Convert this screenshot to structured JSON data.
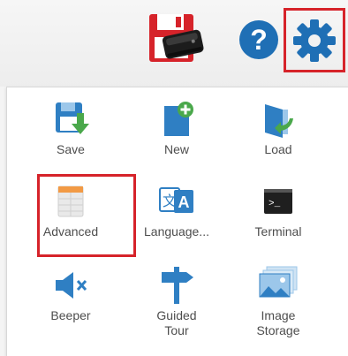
{
  "toolbar": {
    "save_device_icon": "floppy-disk-with-scanner-icon",
    "help_icon": "question-circle-icon",
    "settings_icon": "gear-icon"
  },
  "menu": {
    "items": [
      {
        "label": "Save",
        "icon": "save-down-arrow-icon"
      },
      {
        "label": "New",
        "icon": "new-document-plus-icon"
      },
      {
        "label": "Load",
        "icon": "load-folder-arrow-icon"
      },
      {
        "label": "Advanced",
        "icon": "advanced-table-icon"
      },
      {
        "label": "Language...",
        "icon": "language-translate-icon"
      },
      {
        "label": "Terminal",
        "icon": "terminal-prompt-icon"
      },
      {
        "label": "Beeper",
        "icon": "speaker-mute-icon"
      },
      {
        "label_line1": "Guided",
        "label_line2": "Tour",
        "icon": "signpost-icon"
      },
      {
        "label_line1": "Image",
        "label_line2": "Storage",
        "icon": "image-stack-icon"
      }
    ]
  },
  "colors": {
    "highlight": "#d6232a",
    "icon_blue": "#2f7fc3",
    "icon_green": "#4aa84b",
    "help_blue": "#1f6fb5",
    "label_gray": "#4d4d4d"
  }
}
